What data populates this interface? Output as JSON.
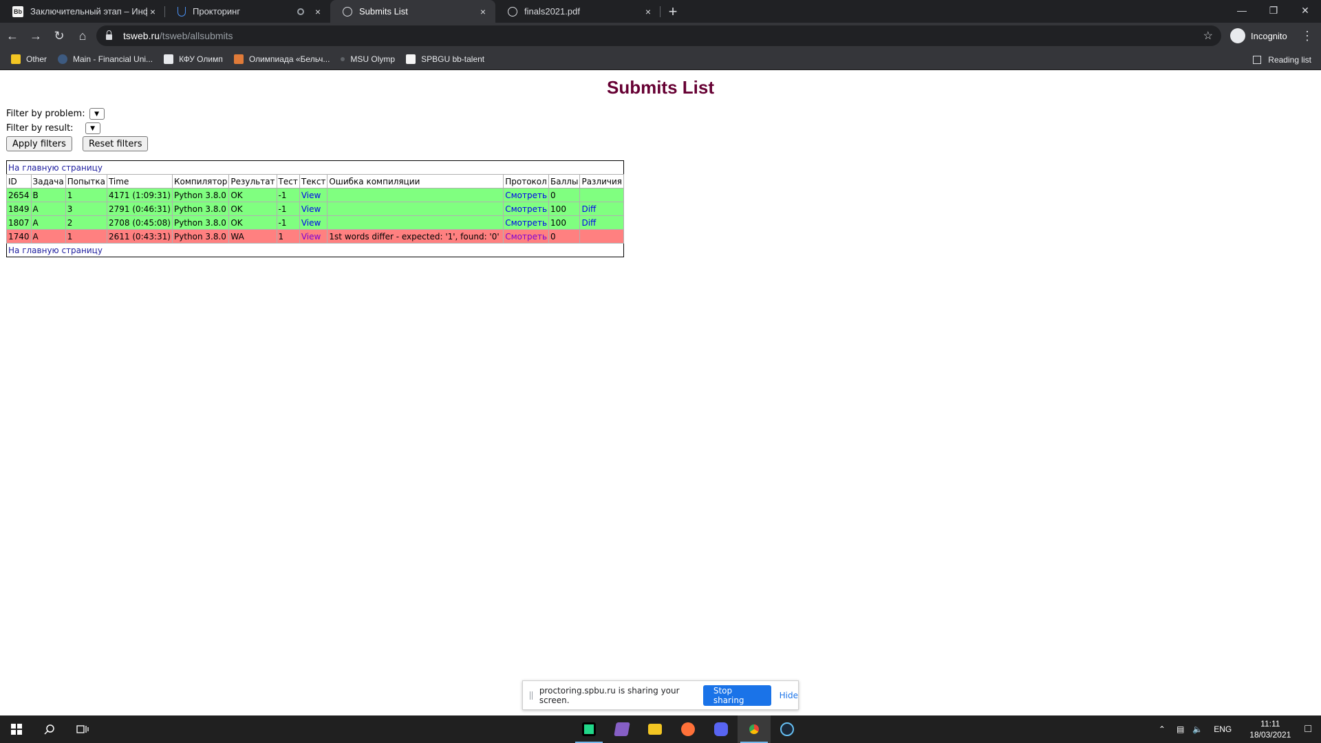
{
  "browser": {
    "tabs": [
      {
        "title": "Заключительный этап – Инфор",
        "icon": "bb-favicon"
      },
      {
        "title": "Прокторинг",
        "icon": "shield-favicon"
      },
      {
        "title": "Submits List",
        "icon": "globe-icon",
        "active": true
      },
      {
        "title": "finals2021.pdf",
        "icon": "globe-icon"
      }
    ],
    "url_host": "tsweb.ru",
    "url_path": "/tsweb/allsubmits",
    "profile_label": "Incognito",
    "bookmarks": [
      "Other",
      "Main - Financial Uni...",
      "КФУ Олимп",
      "Олимпиада «Бельч...",
      "MSU Olymp",
      "SPBGU bb-talent"
    ],
    "reading_list": "Reading list",
    "tab_close_glyph": "×",
    "new_tab_glyph": "+"
  },
  "page": {
    "title": "Submits List",
    "filter_problem_label": "Filter by problem:",
    "filter_result_label": "Filter by result:",
    "apply_filters": "Apply filters",
    "reset_filters": "Reset filters",
    "main_link": "На главную страницу",
    "headers": [
      "ID",
      "Задача",
      "Попытка",
      "Time",
      "Компилятор",
      "Результат",
      "Тест",
      "Текст",
      "Ошибка компиляции",
      "Протокол",
      "Баллы",
      "Различия"
    ],
    "rows": [
      {
        "id": "2654",
        "task": "B",
        "attempt": "1",
        "time": "4171 (1:09:31)",
        "compiler": "Python 3.8.0",
        "result": "OK",
        "test": "-1",
        "text": "View",
        "error": "",
        "protocol": "Смотреть",
        "score": "0",
        "diff": "",
        "status": "ok"
      },
      {
        "id": "1849",
        "task": "A",
        "attempt": "3",
        "time": "2791 (0:46:31)",
        "compiler": "Python 3.8.0",
        "result": "OK",
        "test": "-1",
        "text": "View",
        "error": "",
        "protocol": "Смотреть",
        "score": "100",
        "diff": "Diff",
        "status": "ok"
      },
      {
        "id": "1807",
        "task": "A",
        "attempt": "2",
        "time": "2708 (0:45:08)",
        "compiler": "Python 3.8.0",
        "result": "OK",
        "test": "-1",
        "text": "View",
        "error": "",
        "protocol": "Смотреть",
        "score": "100",
        "diff": "Diff",
        "status": "ok"
      },
      {
        "id": "1740",
        "task": "A",
        "attempt": "1",
        "time": "2611 (0:43:31)",
        "compiler": "Python 3.8.0",
        "result": "WA",
        "test": "1",
        "text": "View",
        "error": "1st words differ - expected: '1', found: '0'",
        "protocol": "Смотреть",
        "score": "0",
        "diff": "",
        "status": "wa"
      }
    ]
  },
  "sharing": {
    "message": "proctoring.spbu.ru is sharing your screen.",
    "stop": "Stop sharing",
    "hide": "Hide"
  },
  "taskbar": {
    "lang": "ENG",
    "time": "11:11",
    "date": "18/03/2021"
  },
  "colors": {
    "ok_row": "#80ff80",
    "wa_row": "#ff8080",
    "title": "#660033",
    "accent": "#1a73e8"
  }
}
